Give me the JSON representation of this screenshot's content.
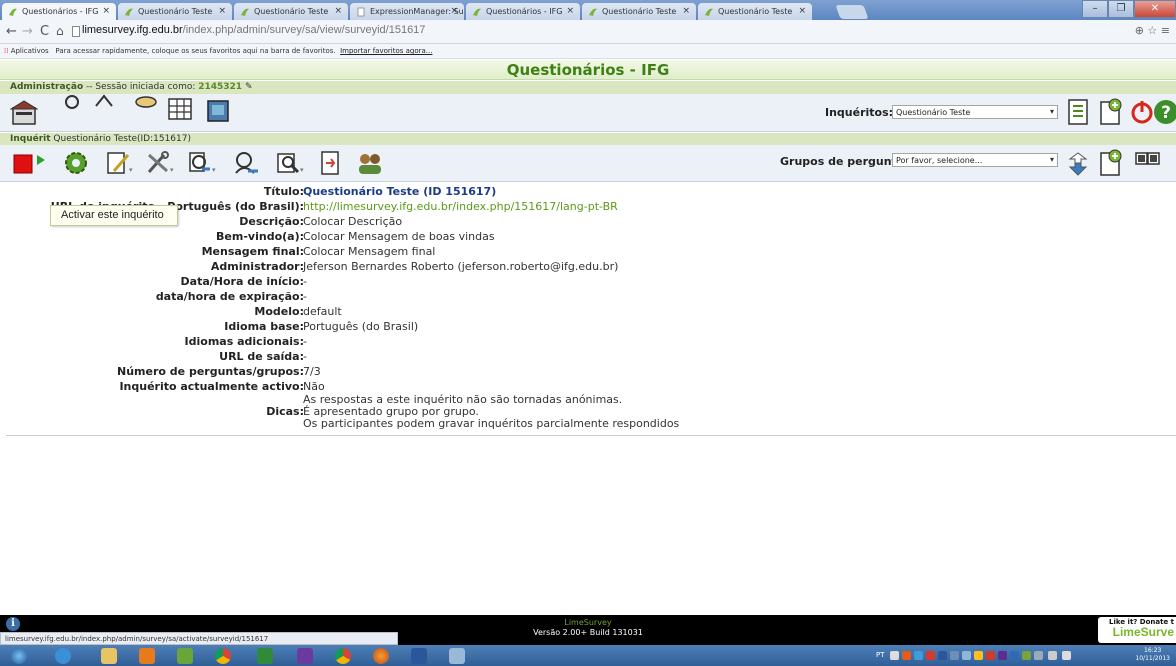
{
  "browser": {
    "tabs": [
      {
        "title": "Questionários - IFG"
      },
      {
        "title": "Questionário Teste"
      },
      {
        "title": "Questionário Teste"
      },
      {
        "title": "ExpressionManager: Surve"
      },
      {
        "title": "Questionários - IFG"
      },
      {
        "title": "Questionário Teste"
      },
      {
        "title": "Questionário Teste"
      }
    ],
    "url_host": "limesurvey.ifg.edu.br",
    "url_path": "/index.php/admin/survey/sa/view/surveyid/151617",
    "bookmarks_apps": "Aplicativos",
    "bookmarks_hint": "Para acessar rapidamente, coloque os seus favoritos aqui na barra de favoritos.",
    "bookmarks_import": "Importar favoritos agora..."
  },
  "app": {
    "title": "Questionários - IFG",
    "admin_label": "Administração",
    "session_text": " -- Sessão iniciada como: ",
    "user_id": "2145321",
    "surveys_label": "Inquéritos:",
    "surveys_selected": "Questionário Teste",
    "tooltip": "Activar este inquérito",
    "survey_label": "Inquérit",
    "survey_name": " Questionário Teste(ID:151617)",
    "groups_label": "Grupos de perguntas:",
    "groups_selected": "Por favor, selecione..."
  },
  "summary": {
    "rows": [
      {
        "label": "Título:",
        "value": "Questionário Teste (ID 151617)"
      },
      {
        "label": "URL do inquérito - Português (do Brasil):",
        "value": "http://limesurvey.ifg.edu.br/index.php/151617/lang-pt-BR"
      },
      {
        "label": "Descrição:",
        "value": "Colocar Descrição"
      },
      {
        "label": "Bem-vindo(a):",
        "value": "Colocar Mensagem de boas vindas"
      },
      {
        "label": "Mensagem final:",
        "value": "Colocar Mensagem final"
      },
      {
        "label": "Administrador:",
        "value": "Jeferson Bernardes Roberto (jeferson.roberto@ifg.edu.br)"
      },
      {
        "label": "Data/Hora de início:",
        "value": "-"
      },
      {
        "label": "data/hora de expiração:",
        "value": "-"
      },
      {
        "label": "Modelo:",
        "value": "default"
      },
      {
        "label": "Idioma base:",
        "value": "Português (do Brasil)"
      },
      {
        "label": "Idiomas adicionais:",
        "value": "-"
      },
      {
        "label": "URL de saída:",
        "value": "-"
      },
      {
        "label": "Número de perguntas/grupos:",
        "value": "7/3"
      },
      {
        "label": "Inquérito actualmente activo:",
        "value": "Não"
      }
    ],
    "hints_label": "Dicas:",
    "hints": [
      "As respostas a este inquérito não são tornadas anónimas.",
      "É apresentado grupo por grupo.",
      "Os participantes podem gravar inquéritos parcialmente respondidos"
    ]
  },
  "footer": {
    "brand": "LimeSurvey",
    "version": "Versão 2.00+ Build 131031",
    "status_url": "limesurvey.ifg.edu.br/index.php/admin/survey/sa/activate/surveyid/151617",
    "donate_top": "Like it? Donate t",
    "donate_brand": "LimeSurve"
  },
  "taskbar": {
    "time": "16:23",
    "date": "10/11/2013",
    "lang": "PT"
  },
  "colors": {
    "brand_green": "#3f8014",
    "link_green": "#5a9a19",
    "title_blue": "#1a3a8a"
  }
}
